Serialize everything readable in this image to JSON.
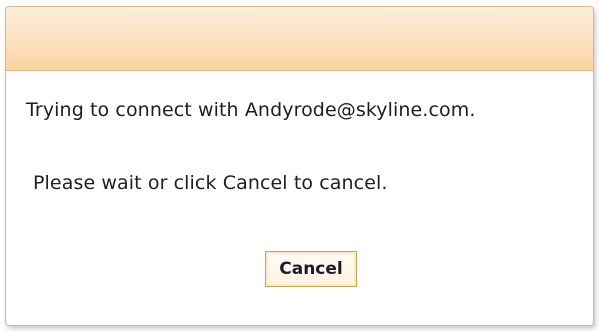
{
  "dialog": {
    "message_connect": "Trying to connect with Andyrode@skyline.com.",
    "message_wait": "Please wait or click Cancel to cancel.",
    "cancel_label": "Cancel"
  },
  "colors": {
    "header_gradient_top": "#fdeedb",
    "header_gradient_bottom": "#fbd2a3",
    "border": "#d9b980",
    "button_border": "#c9a35a"
  }
}
